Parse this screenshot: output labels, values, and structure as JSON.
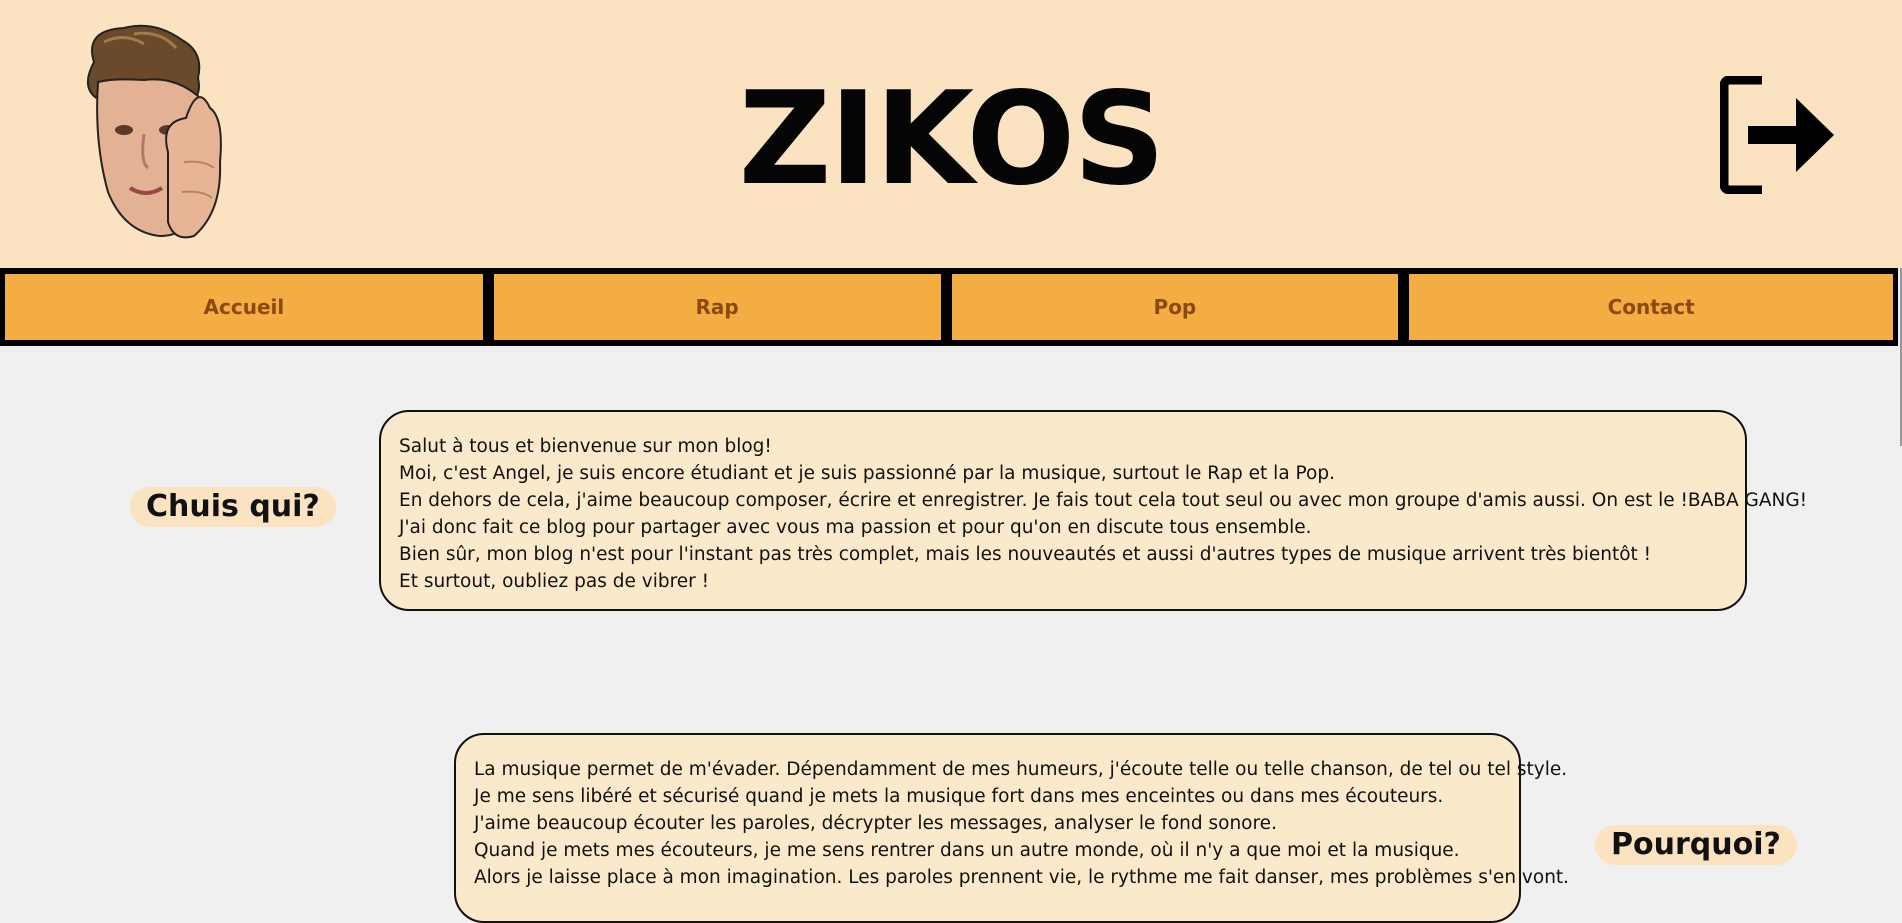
{
  "header": {
    "title": "ZIKOS",
    "avatar_icon": "avatar-photo",
    "logout_icon": "logout-icon"
  },
  "nav": {
    "items": [
      {
        "label": "Accueil"
      },
      {
        "label": "Rap"
      },
      {
        "label": "Pop"
      },
      {
        "label": "Contact"
      }
    ]
  },
  "sections": [
    {
      "label": "Chuis qui?",
      "lines": [
        "Salut à tous et bienvenue sur mon blog!",
        "Moi, c'est Angel, je suis encore étudiant et je suis passionné par la musique, surtout le Rap et la Pop.",
        "En dehors de cela, j'aime beaucoup composer, écrire et enregistrer. Je fais tout cela tout seul ou avec mon groupe d'amis aussi. On est le !BABA GANG!",
        "J'ai donc fait ce blog pour partager avec vous ma passion et pour qu'on en discute tous ensemble.",
        "Bien sûr, mon blog n'est pour l'instant pas très complet, mais les nouveautés et aussi d'autres types de musique arrivent très bientôt !",
        "Et surtout, oubliez pas de vibrer !"
      ]
    },
    {
      "label": "Pourquoi?",
      "lines": [
        "La musique permet de m'évader. Dépendamment de mes humeurs, j'écoute telle ou telle chanson, de tel ou tel style.",
        "Je me sens libéré et sécurisé quand je mets la musique fort dans mes enceintes ou dans mes écouteurs.",
        "J'aime beaucoup écouter les paroles, décrypter les messages, analyser le fond sonore.",
        "Quand je mets mes écouteurs, je me sens rentrer dans un autre monde, où il n'y a que moi et la musique.",
        "Alors je laisse place à mon imagination. Les paroles prennent vie, le rythme me fait danser, mes problèmes s'en vont."
      ]
    }
  ],
  "colors": {
    "header_bg": "#fbe3c1",
    "nav_bg": "#f4ad42",
    "nav_text": "#8a4a12",
    "card_bg": "#fbe9cb",
    "page_bg": "#f0f0f0"
  }
}
